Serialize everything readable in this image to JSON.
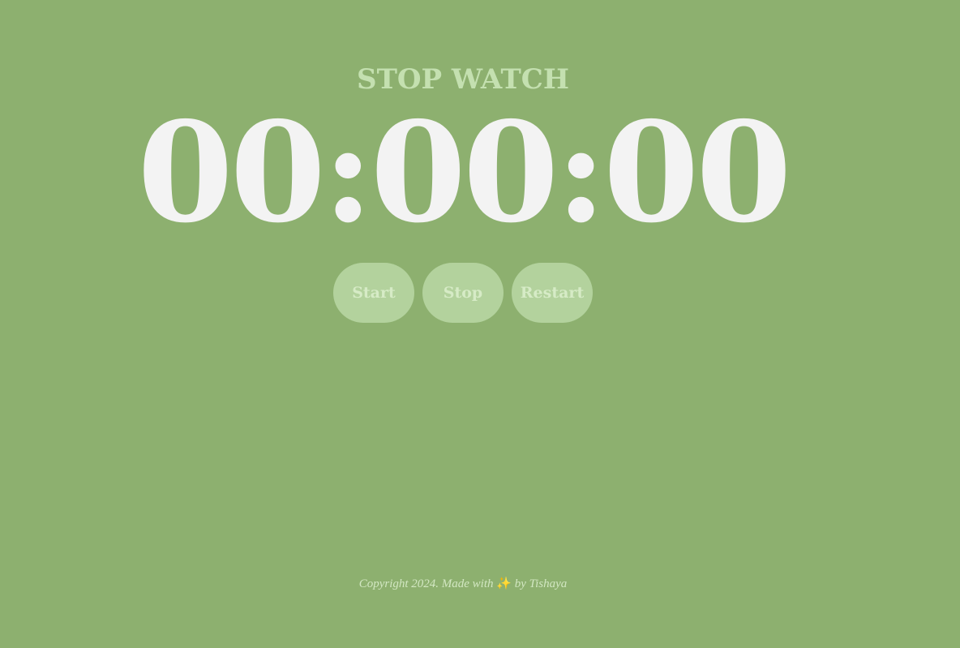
{
  "header": {
    "title": "STOP WATCH"
  },
  "clock": {
    "display": "00:00:00"
  },
  "controls": {
    "start_label": "Start",
    "stop_label": "Stop",
    "restart_label": "Restart"
  },
  "footer": {
    "prefix": "Copyright 2024. Made with ",
    "emoji": "✨",
    "suffix": " by Tishaya"
  },
  "colors": {
    "background": "#8db06f",
    "title": "#c4e0b0",
    "clock_text": "#f3f3f3",
    "button_bg": "#b3d29d",
    "button_text": "#d6ebc6"
  }
}
